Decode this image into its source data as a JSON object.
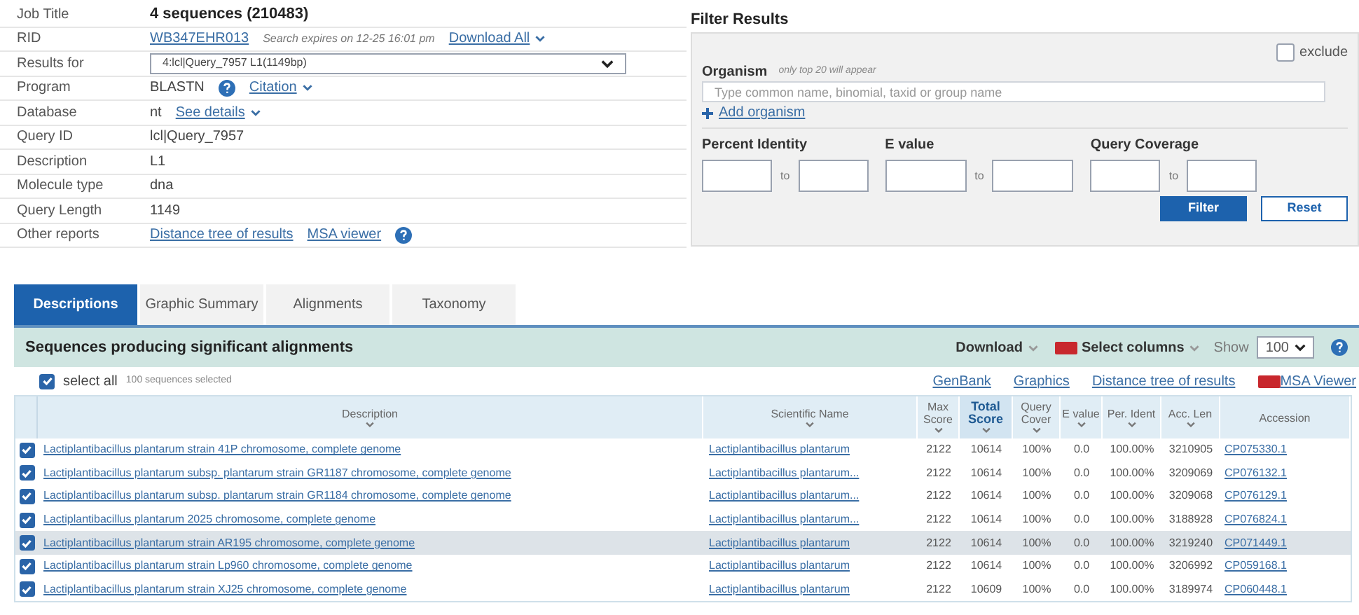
{
  "job_info": [
    {
      "label": "Job Title",
      "parts": [
        {
          "kind": "bold",
          "text": "4 sequences (210483)"
        }
      ]
    },
    {
      "label": "RID",
      "parts": [
        {
          "kind": "link",
          "text": "WB347EHR013"
        },
        {
          "kind": "note",
          "text": "Search expires on 12-25 16:01 pm"
        },
        {
          "kind": "link",
          "text": "Download All",
          "dropdown": true
        }
      ]
    },
    {
      "label": "Results for",
      "parts": [
        {
          "kind": "select",
          "text": "4:lcl|Query_7957 L1(1149bp)"
        }
      ]
    },
    {
      "label": "Program",
      "parts": [
        {
          "kind": "plain",
          "text": "BLASTN"
        },
        {
          "kind": "help"
        },
        {
          "kind": "link",
          "text": "Citation",
          "dropdown": true
        }
      ]
    },
    {
      "label": "Database",
      "parts": [
        {
          "kind": "plain",
          "text": "nt"
        },
        {
          "kind": "link",
          "text": "See details",
          "dropdown": true
        }
      ]
    },
    {
      "label": "Query ID",
      "parts": [
        {
          "kind": "plain",
          "text": "lcl|Query_7957"
        }
      ]
    },
    {
      "label": "Description",
      "parts": [
        {
          "kind": "plain",
          "text": "L1"
        }
      ]
    },
    {
      "label": "Molecule type",
      "parts": [
        {
          "kind": "plain",
          "text": "dna"
        }
      ]
    },
    {
      "label": "Query Length",
      "parts": [
        {
          "kind": "plain",
          "text": "1149"
        }
      ]
    },
    {
      "label": "Other reports",
      "parts": [
        {
          "kind": "link",
          "text": "Distance tree of results"
        },
        {
          "kind": "link",
          "text": "MSA viewer"
        },
        {
          "kind": "help"
        }
      ]
    }
  ],
  "filter": {
    "title": "Filter Results",
    "organism_label": "Organism",
    "organism_note": "only top 20 will appear",
    "exclude": {
      "label": "exclude",
      "checked": false
    },
    "placeholder": "Type common name, binomial, taxid or group name",
    "add_link": "Add organism",
    "ranges": [
      {
        "label": "Percent Identity",
        "to": "to"
      },
      {
        "label": "E value",
        "to": "to"
      },
      {
        "label": "Query Coverage",
        "to": "to"
      }
    ],
    "buttons": [
      {
        "label": "Filter",
        "kind": "primary"
      },
      {
        "label": "Reset",
        "kind": "secondary"
      }
    ]
  },
  "tabs": [
    {
      "label": "Descriptions",
      "selected": true
    },
    {
      "label": "Graphic Summary",
      "selected": false
    },
    {
      "label": "Alignments",
      "selected": false
    },
    {
      "label": "Taxonomy",
      "selected": false
    }
  ],
  "results_bar": {
    "title": "Sequences producing significant alignments",
    "download": "Download",
    "select_columns": "Select columns",
    "show_label": "Show",
    "show_value": "100"
  },
  "select_all": {
    "checked": true,
    "label": "select all",
    "note": "100 sequences selected"
  },
  "links": [
    {
      "text": "GenBank",
      "new": false
    },
    {
      "text": "Graphics",
      "new": false
    },
    {
      "text": "Distance tree of results",
      "new": false
    },
    {
      "text": "MSA Viewer",
      "new": true
    }
  ],
  "table": {
    "columns": [
      {
        "label": "Description",
        "sortable": true,
        "sorted": false
      },
      {
        "label": "Scientific Name",
        "sortable": true,
        "sorted": false
      },
      {
        "label": "Max Score",
        "sortable": true,
        "sorted": false
      },
      {
        "label": "Total Score",
        "sortable": true,
        "sorted": true
      },
      {
        "label": "Query Cover",
        "sortable": true,
        "sorted": false
      },
      {
        "label": "E value",
        "sortable": true,
        "sorted": false
      },
      {
        "label": "Per. Ident",
        "sortable": true,
        "sorted": false
      },
      {
        "label": "Acc. Len",
        "sortable": true,
        "sorted": false
      },
      {
        "label": "Accession",
        "sortable": false,
        "sorted": false
      }
    ],
    "rows": [
      {
        "checked": true,
        "selected": false,
        "cells": [
          "Lactiplantibacillus plantarum strain 41P chromosome, complete genome",
          "Lactiplantibacillus plantarum",
          "2122",
          "10614",
          "100%",
          "0.0",
          "100.00%",
          "3210905",
          "CP075330.1"
        ]
      },
      {
        "checked": true,
        "selected": false,
        "cells": [
          "Lactiplantibacillus plantarum subsp. plantarum strain GR1187 chromosome, complete genome",
          "Lactiplantibacillus plantarum...",
          "2122",
          "10614",
          "100%",
          "0.0",
          "100.00%",
          "3209069",
          "CP076132.1"
        ]
      },
      {
        "checked": true,
        "selected": false,
        "cells": [
          "Lactiplantibacillus plantarum subsp. plantarum strain GR1184 chromosome, complete genome",
          "Lactiplantibacillus plantarum...",
          "2122",
          "10614",
          "100%",
          "0.0",
          "100.00%",
          "3209068",
          "CP076129.1"
        ]
      },
      {
        "checked": true,
        "selected": false,
        "cells": [
          "Lactiplantibacillus plantarum 2025 chromosome, complete genome",
          "Lactiplantibacillus plantarum...",
          "2122",
          "10614",
          "100%",
          "0.0",
          "100.00%",
          "3188928",
          "CP076824.1"
        ]
      },
      {
        "checked": true,
        "selected": true,
        "cells": [
          "Lactiplantibacillus plantarum strain AR195 chromosome, complete genome",
          "Lactiplantibacillus plantarum",
          "2122",
          "10614",
          "100%",
          "0.0",
          "100.00%",
          "3219240",
          "CP071449.1"
        ]
      },
      {
        "checked": true,
        "selected": false,
        "cells": [
          "Lactiplantibacillus plantarum strain Lp960 chromosome, complete genome",
          "Lactiplantibacillus plantarum",
          "2122",
          "10614",
          "100%",
          "0.0",
          "100.00%",
          "3206992",
          "CP059168.1"
        ]
      },
      {
        "checked": true,
        "selected": false,
        "cells": [
          "Lactiplantibacillus plantarum strain XJ25 chromosome, complete genome",
          "Lactiplantibacillus plantarum",
          "2122",
          "10609",
          "100%",
          "0.0",
          "100.00%",
          "3189974",
          "CP060448.1"
        ]
      }
    ]
  }
}
